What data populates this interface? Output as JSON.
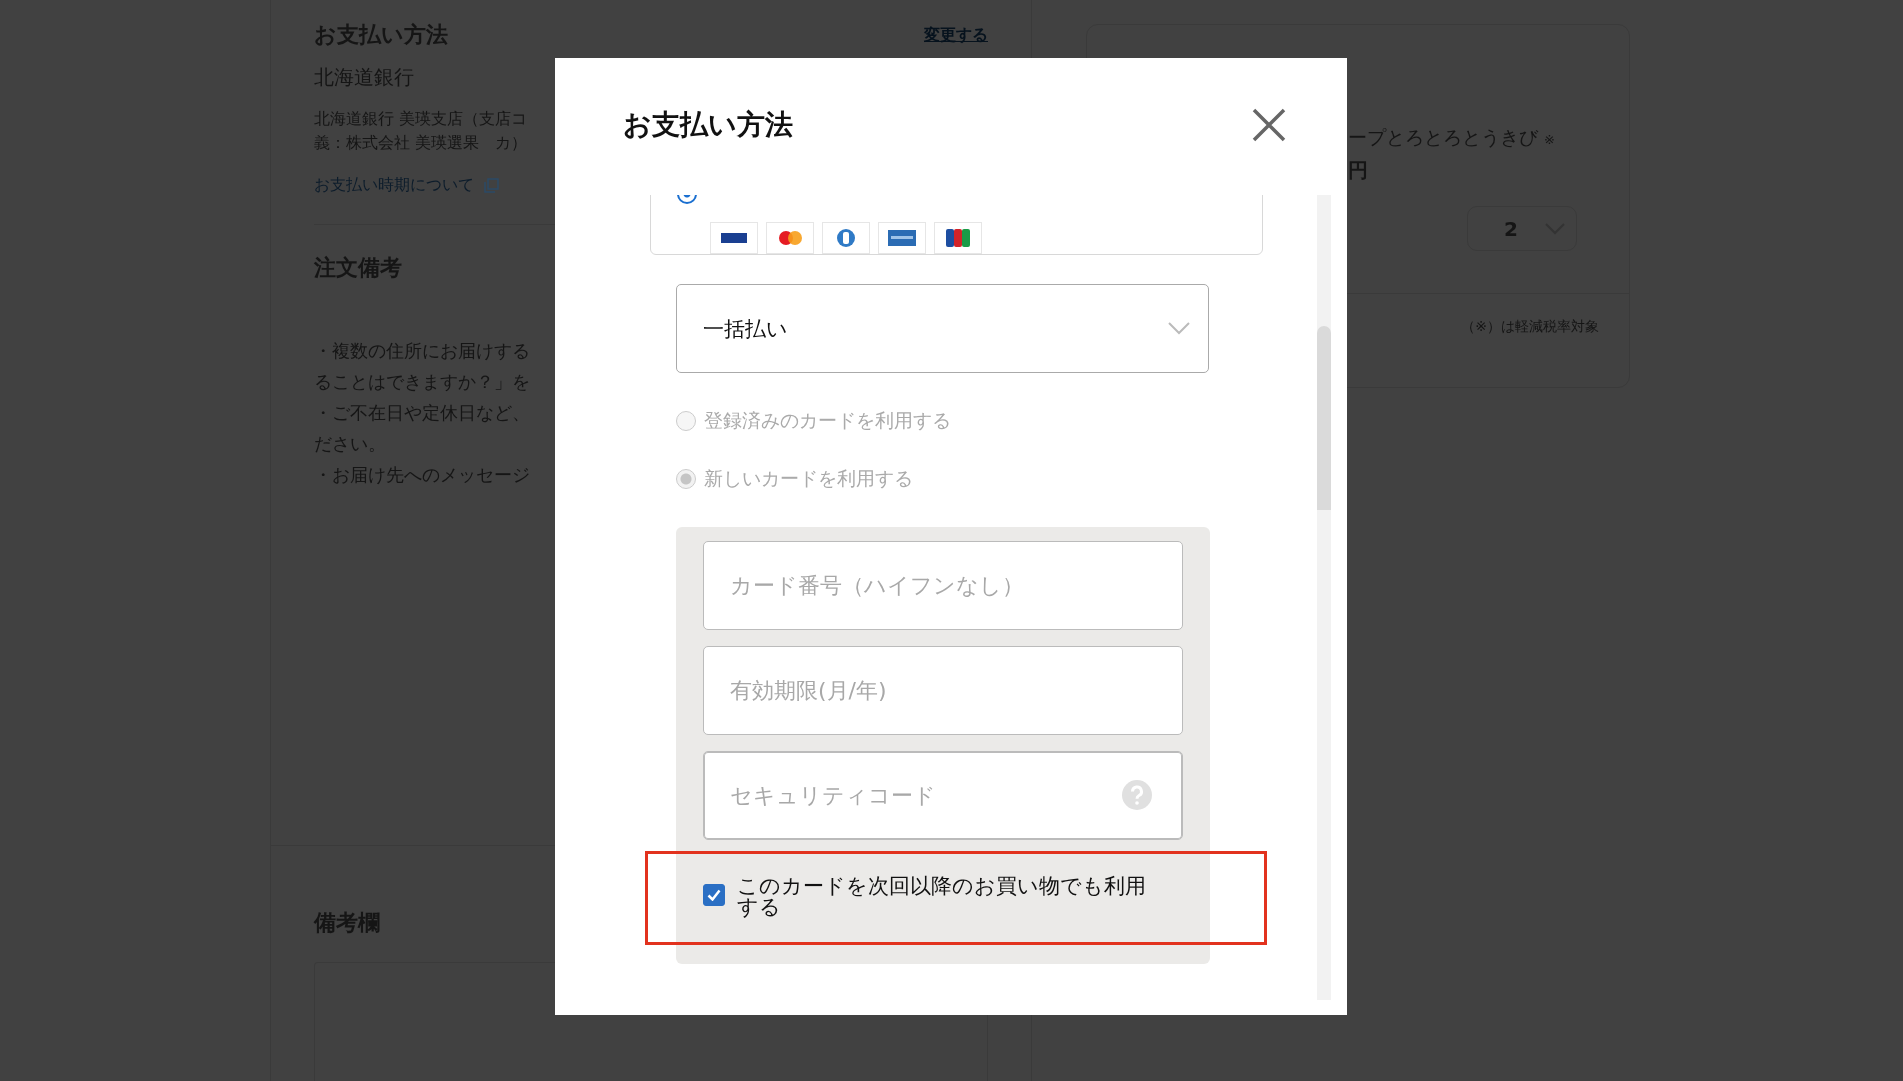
{
  "background_page": {
    "payment_section": {
      "heading": "お支払い方法",
      "change_link": "変更する",
      "bank_name": "北海道銀行",
      "bank_detail_lines": [
        "北海道銀行 美瑛支店（支店コ",
        "義：株式会社 美瑛選果　カ）"
      ],
      "timing_link": "お支払い時期について"
    },
    "order_notes": {
      "heading": "注文備考",
      "lines": [
        "・複数の住所にお届けする",
        "ることはできますか？」を",
        "・ご不在日や定休日など、",
        "ださい。",
        "・お届け先へのメッセージ"
      ]
    },
    "remarks": {
      "heading": "備考欄"
    },
    "order_summary": {
      "product_name": "ープとろとろとうきび",
      "tax_mark": "※",
      "price": "円",
      "quantity": "2",
      "footnote": "（※）は軽減税率対象"
    }
  },
  "modal": {
    "title": "お支払い方法",
    "card_option": {
      "selected": true
    },
    "installment_select": {
      "value": "一括払い"
    },
    "card_choices": [
      {
        "label": "登録済みのカードを利用する",
        "selected": false,
        "disabled": true
      },
      {
        "label": "新しいカードを利用する",
        "selected": true,
        "disabled": true
      }
    ],
    "card_fields": [
      {
        "kind": "text",
        "placeholder": "カード番号（ハイフンなし）",
        "focused": false
      },
      {
        "kind": "text",
        "placeholder": "有効期限(月/年)",
        "focused": false
      },
      {
        "kind": "help",
        "placeholder": "セキュリティコード",
        "focused": true
      }
    ],
    "save_card": {
      "label": "このカードを次回以降のお買い物でも利用する",
      "checked": true
    },
    "annotation": {
      "kind": "highlight"
    }
  }
}
